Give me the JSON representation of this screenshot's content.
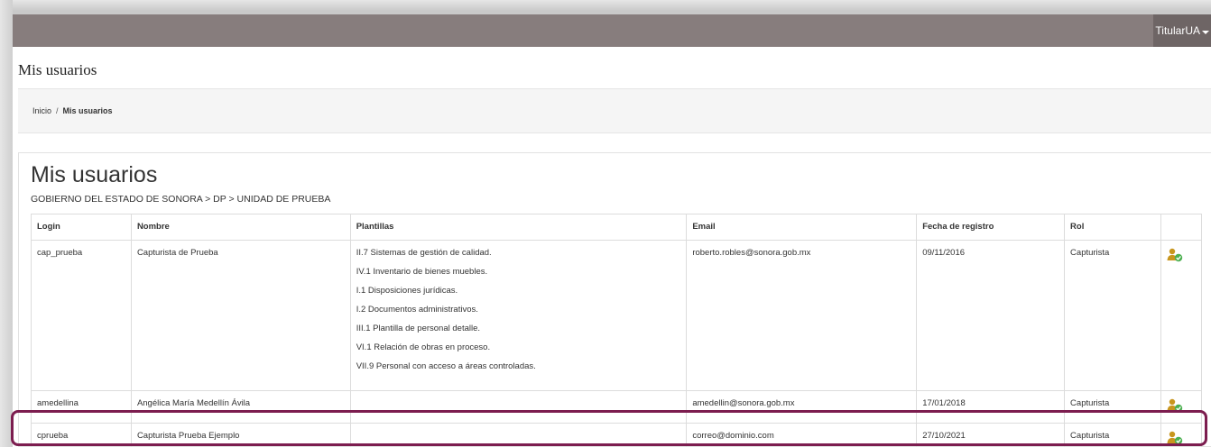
{
  "topbar": {
    "user_menu_label": "TitularUA"
  },
  "page": {
    "title": "Mis usuarios"
  },
  "breadcrumb": {
    "home": "Inicio",
    "separator": "/",
    "current": "Mis usuarios"
  },
  "panel": {
    "title": "Mis usuarios",
    "org_path": "GOBIERNO DEL ESTADO DE SONORA > DP > UNIDAD DE PRUEBA"
  },
  "table": {
    "headers": [
      "Login",
      "Nombre",
      "Plantillas",
      "Email",
      "Fecha de registro",
      "Rol",
      ""
    ],
    "rows": [
      {
        "login": "cap_prueba",
        "nombre": "Capturista de Prueba",
        "plantillas": [
          "II.7 Sistemas de gestión de calidad.",
          "IV.1 Inventario de bienes muebles.",
          "I.1 Disposiciones jurídicas.",
          "I.2 Documentos administrativos.",
          "III.1 Plantilla de personal detalle.",
          "VI.1 Relación de obras en proceso.",
          "VII.9 Personal con acceso a áreas controladas."
        ],
        "email": "roberto.robles@sonora.gob.mx",
        "fecha": "09/11/2016",
        "rol": "Capturista"
      },
      {
        "login": "amedellina",
        "nombre": "Angélica María Medellín Ávila",
        "plantillas": [],
        "email": "amedellin@sonora.gob.mx",
        "fecha": "17/01/2018",
        "rol": "Capturista"
      },
      {
        "login": "cprueba",
        "nombre": "Capturista Prueba Ejemplo",
        "plantillas": [],
        "email": "correo@dominio.com",
        "fecha": "27/10/2021",
        "rol": "Capturista"
      }
    ]
  },
  "icons": {
    "row_action": "user-edit-icon"
  },
  "colors": {
    "topbar": "#877d7d",
    "user_menu": "#6e6565",
    "highlight": "#7c1d4f",
    "icon_green": "#4caf50",
    "icon_gold": "#c8961e"
  }
}
